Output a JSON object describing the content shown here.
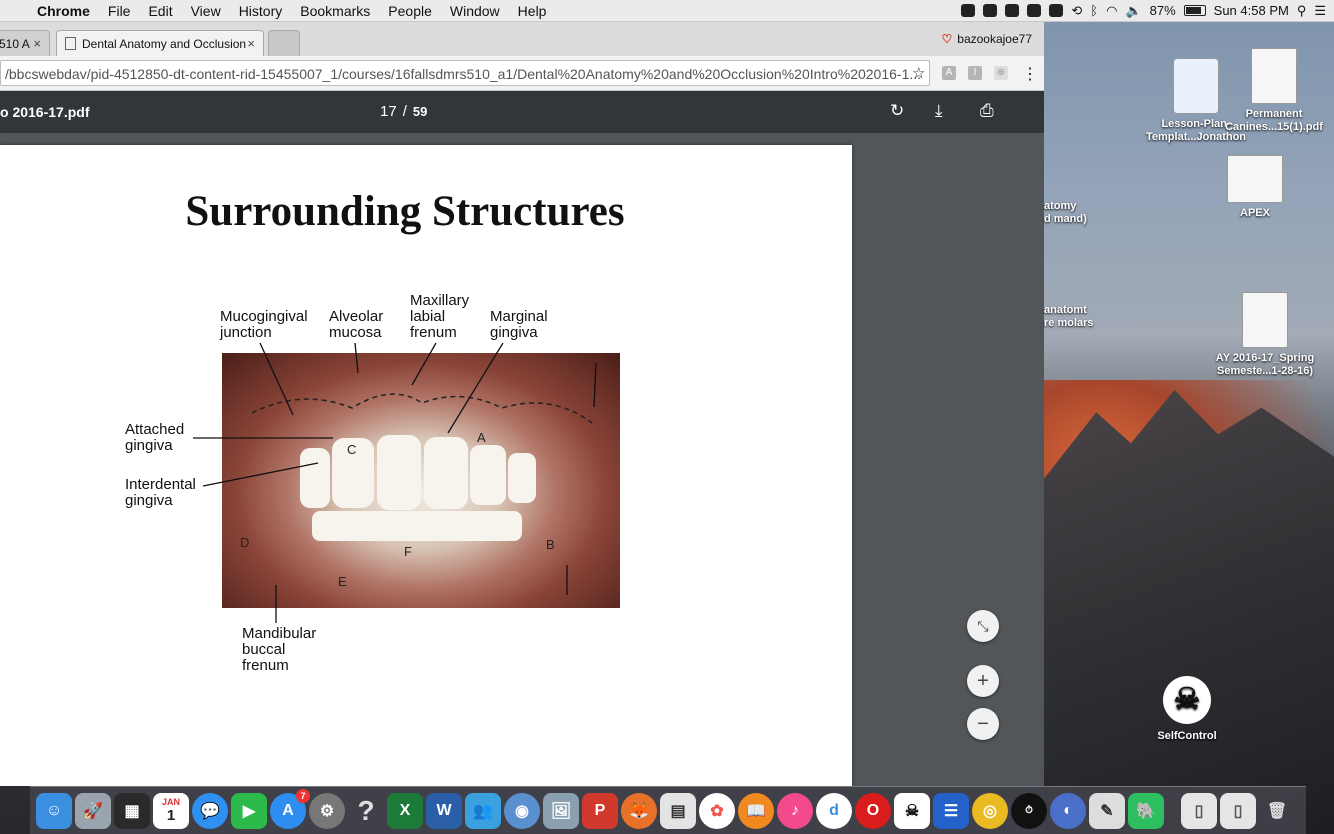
{
  "menubar": {
    "apple": "",
    "app_name": "Chrome",
    "items": [
      "File",
      "Edit",
      "View",
      "History",
      "Bookmarks",
      "People",
      "Window",
      "Help"
    ],
    "battery": "87%",
    "clock": "Sun 4:58 PM"
  },
  "tabs": {
    "tab1_label": "510 A",
    "tab2_label": "Dental Anatomy and Occlusion",
    "close": "×"
  },
  "profile": {
    "name": "bazookajoe77"
  },
  "toolbar": {
    "url": "/bbcswebdav/pid-4512850-dt-content-rid-15455007_1/courses/16fallsdmrs510_a1/Dental%20Anatomy%20and%20Occlusion%20Intro%202016-1...",
    "star": "☆",
    "ext1": "A",
    "ext2": "I",
    "ext3": "⊕",
    "menu": "⋮"
  },
  "pdf": {
    "title": "o 2016-17.pdf",
    "page_current": "17",
    "page_sep": "/",
    "page_total": "59",
    "rotate_icon": "↻",
    "download_icon": "⤓",
    "print_icon": "⎙"
  },
  "slide": {
    "title": "Surrounding Structures",
    "labels": {
      "mucogingival": "Mucogingival\njunction",
      "alveolar": "Alveolar\nmucosa",
      "maxillary": "Maxillary\nlabial\nfrenum",
      "marginal": "Marginal\ngingiva",
      "attached": "Attached\ngingiva",
      "interdental": "Interdental\ngingiva",
      "mandibular": "Mandibular\nbuccal\nfrenum"
    },
    "letters": {
      "A": "A",
      "B": "B",
      "C": "C",
      "D": "D",
      "E": "E",
      "F": "F"
    }
  },
  "zoom": {
    "fit": "⤡",
    "plus": "+",
    "minus": "−"
  },
  "desktop_icons": [
    {
      "label": "Lesson-Plan-\nTemplat...Jonathon"
    },
    {
      "label": "Permanent\nCanines...15(1).pdf"
    },
    {
      "label": "APEX"
    },
    {
      "label": "atomy\nd mand)"
    },
    {
      "label": "anatomt\nre molars"
    },
    {
      "label": "AY 2016-17_Spring\nSemeste...1-28-16)"
    },
    {
      "label": "SelfControl"
    }
  ],
  "dock": {
    "calendar_month": "JAN",
    "calendar_day": "1",
    "appstore_badge": "7"
  }
}
